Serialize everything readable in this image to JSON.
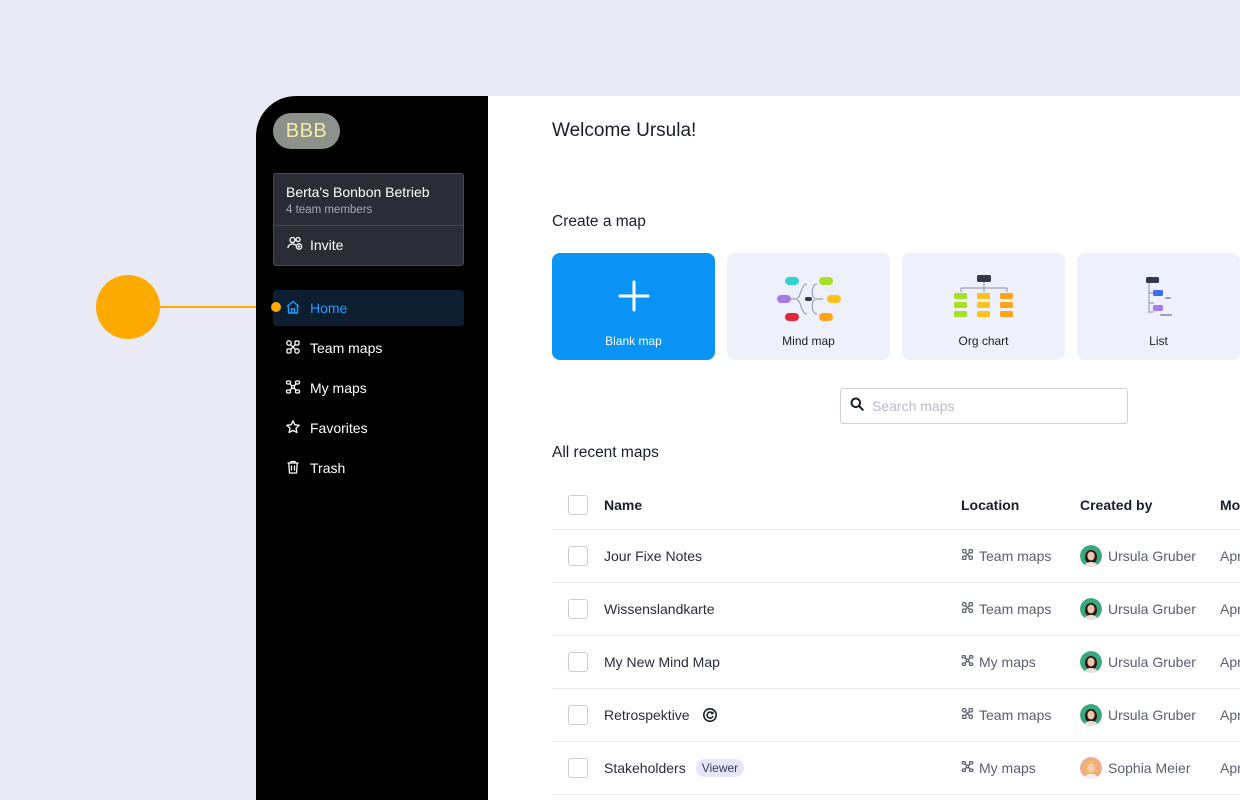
{
  "sidebar": {
    "team_initials": "BBB",
    "team_name": "Berta's Bonbon Betrieb",
    "team_members": "4 team members",
    "invite_label": "Invite",
    "nav": [
      {
        "label": "Home",
        "icon": "home-icon",
        "active": true
      },
      {
        "label": "Team maps",
        "icon": "team-maps-icon"
      },
      {
        "label": "My maps",
        "icon": "my-maps-icon"
      },
      {
        "label": "Favorites",
        "icon": "star-icon"
      },
      {
        "label": "Trash",
        "icon": "trash-icon"
      }
    ]
  },
  "main": {
    "welcome": "Welcome Ursula!",
    "create_title": "Create a map",
    "cards": [
      {
        "label": "Blank map",
        "icon": "plus-icon"
      },
      {
        "label": "Mind map",
        "icon": "mind-map-icon"
      },
      {
        "label": "Org chart",
        "icon": "org-chart-icon"
      },
      {
        "label": "List",
        "icon": "list-icon"
      }
    ],
    "search_placeholder": "Search maps",
    "recent_title": "All recent maps",
    "table": {
      "headers": {
        "name": "Name",
        "location": "Location",
        "created_by": "Created by",
        "modified": "Mo"
      },
      "rows": [
        {
          "name": "Jour Fixe Notes",
          "location": "Team maps",
          "created_by": "Ursula Gruber",
          "modified": "Apr"
        },
        {
          "name": "Wissenslandkarte",
          "location": "Team maps",
          "created_by": "Ursula Gruber",
          "modified": "Apr"
        },
        {
          "name": "My New Mind Map",
          "location": "My maps",
          "created_by": "Ursula Gruber",
          "modified": "Apr"
        },
        {
          "name": "Retrospektive",
          "location": "Team maps",
          "created_by": "Ursula Gruber",
          "modified": "Apr",
          "extra_icon": "sync-icon"
        },
        {
          "name": "Stakeholders",
          "badge": "Viewer",
          "location": "My maps",
          "created_by": "Sophia Meier",
          "modified": "Apr"
        }
      ]
    }
  },
  "colors": {
    "accent": "#0a94f5",
    "callout": "#ffaa00",
    "sidebar_bg": "#000000",
    "active_nav_text": "#1ca0ff"
  }
}
